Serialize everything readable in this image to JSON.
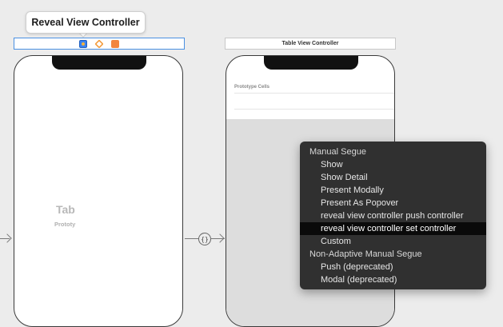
{
  "tooltip": {
    "text": "Reveal View Controller"
  },
  "left_scene": {
    "dock_icons": [
      "view-controller-icon",
      "first-responder-icon",
      "exit-icon"
    ]
  },
  "right_scene": {
    "dock_title": "Table View Controller",
    "prototype_cells_label": "Prototype Cells",
    "table_view_label": "Tab",
    "prototype_content_label": "Prototy"
  },
  "segue_icon": "{}",
  "context_menu": {
    "items": [
      {
        "label": "Manual Segue",
        "type": "header"
      },
      {
        "label": "Show",
        "type": "item"
      },
      {
        "label": "Show Detail",
        "type": "item"
      },
      {
        "label": "Present Modally",
        "type": "item"
      },
      {
        "label": "Present As Popover",
        "type": "item"
      },
      {
        "label": "reveal view controller push controller",
        "type": "item"
      },
      {
        "label": "reveal view controller set controller",
        "type": "item",
        "selected": true
      },
      {
        "label": "Custom",
        "type": "item"
      },
      {
        "label": "Non-Adaptive Manual Segue",
        "type": "header"
      },
      {
        "label": "Push (deprecated)",
        "type": "item"
      },
      {
        "label": "Modal (deprecated)",
        "type": "item"
      }
    ]
  }
}
